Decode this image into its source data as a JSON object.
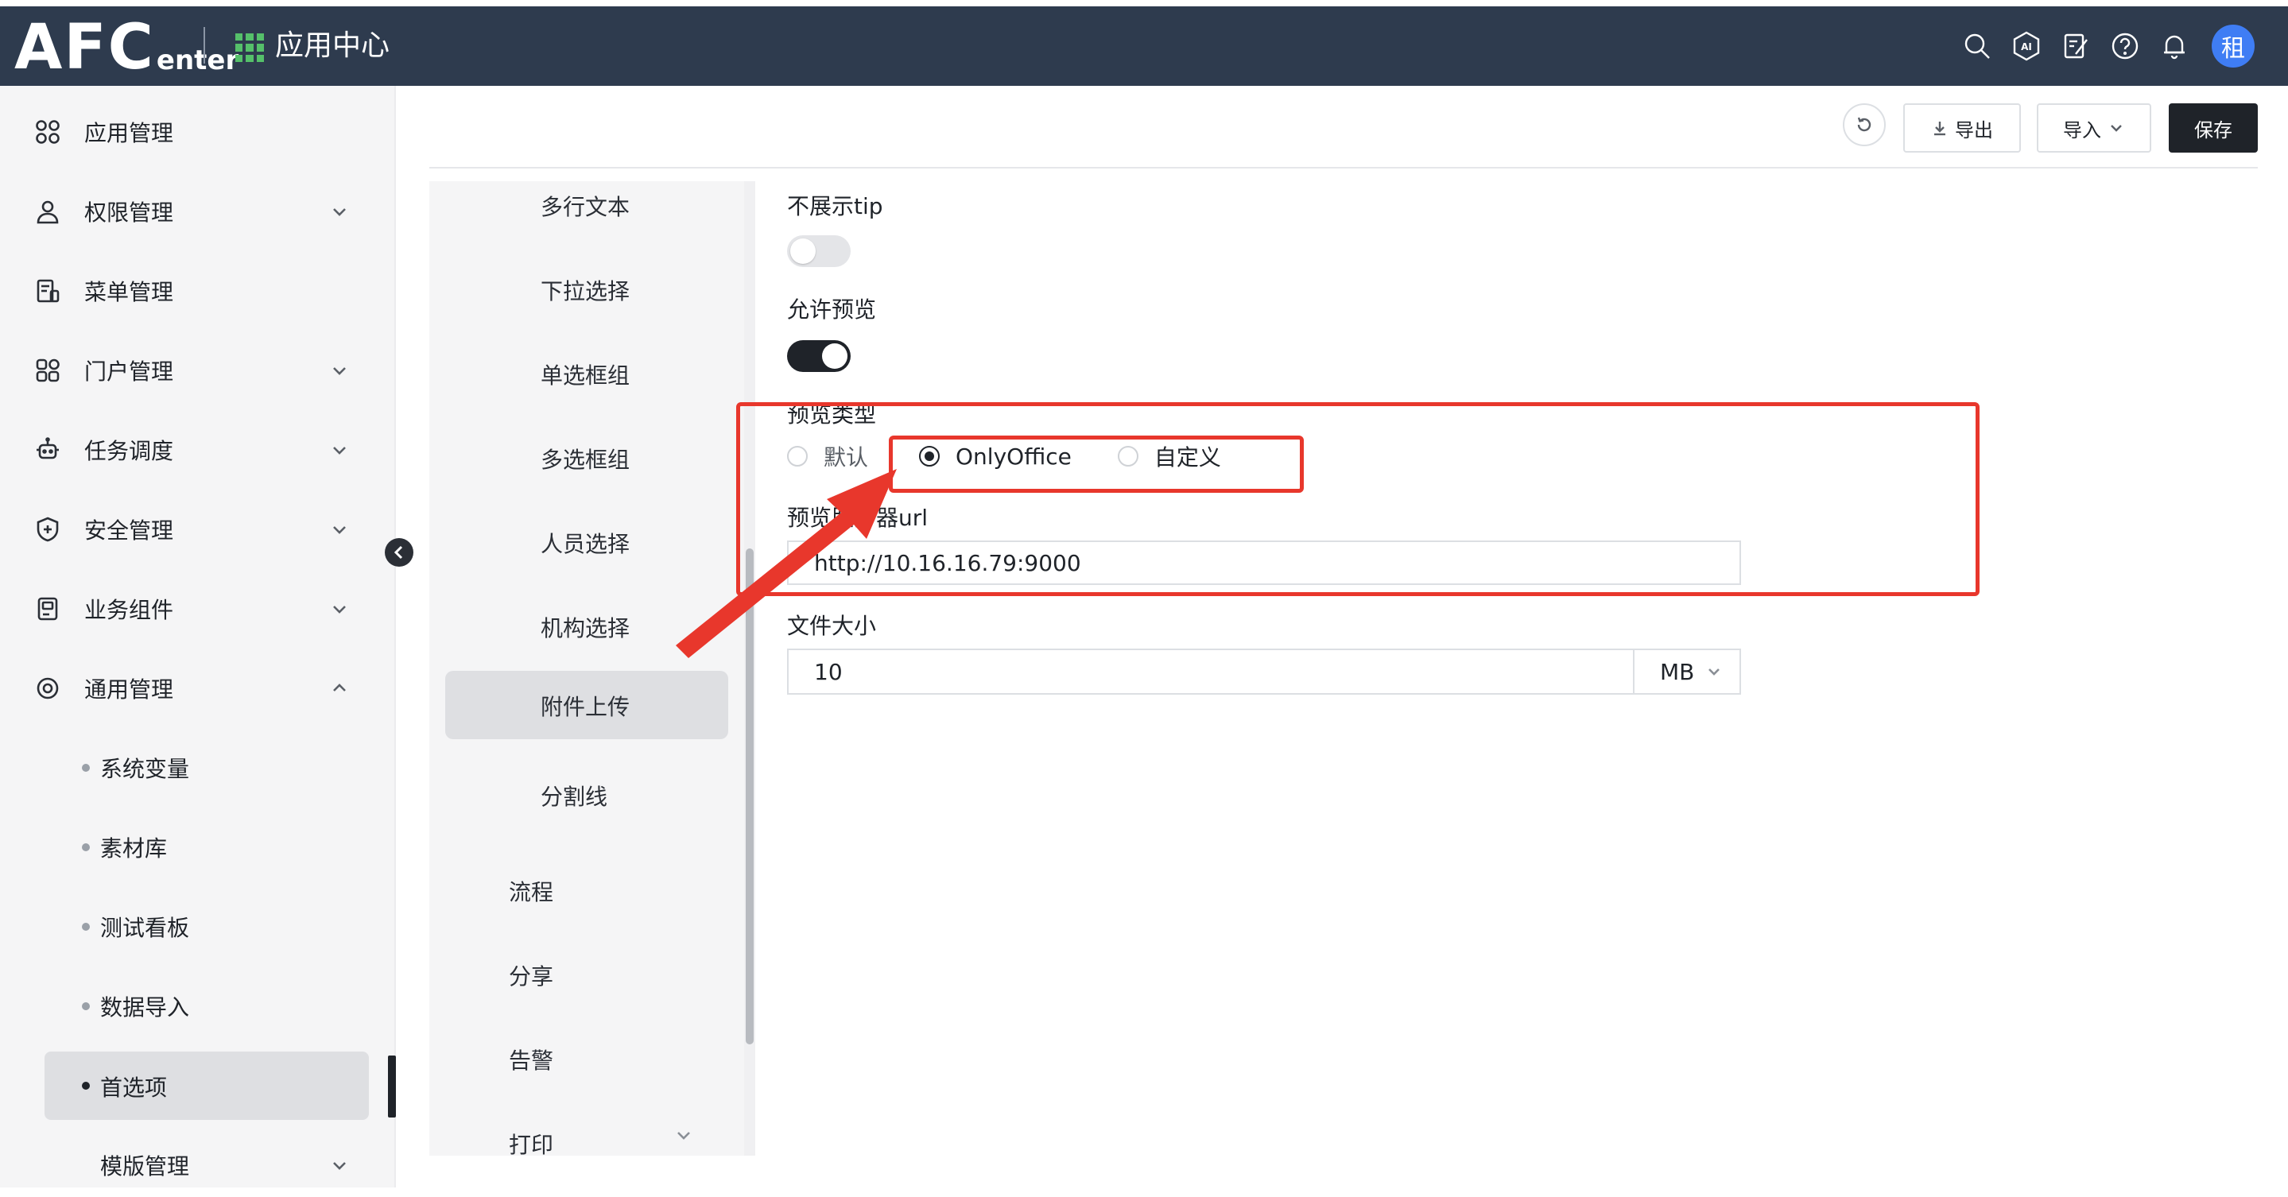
{
  "header": {
    "logo_main": "AFC",
    "logo_sub": "enter",
    "app_center": "应用中心",
    "avatar_text": "租",
    "icons": [
      "search-icon",
      "ai-icon",
      "edit-note-icon",
      "help-icon",
      "bell-icon"
    ]
  },
  "sidebar": {
    "items": [
      {
        "label": "应用管理",
        "icon": "grid-apps-icon",
        "expandable": false
      },
      {
        "label": "权限管理",
        "icon": "user-icon",
        "expandable": true
      },
      {
        "label": "菜单管理",
        "icon": "menu-doc-icon",
        "expandable": false
      },
      {
        "label": "门户管理",
        "icon": "portal-icon",
        "expandable": true
      },
      {
        "label": "任务调度",
        "icon": "robot-icon",
        "expandable": true
      },
      {
        "label": "安全管理",
        "icon": "shield-icon",
        "expandable": true
      },
      {
        "label": "业务组件",
        "icon": "component-icon",
        "expandable": true
      },
      {
        "label": "通用管理",
        "icon": "target-icon",
        "expandable": true,
        "expanded": true
      }
    ],
    "sub_items": [
      {
        "label": "系统变量"
      },
      {
        "label": "素材库"
      },
      {
        "label": "测试看板"
      },
      {
        "label": "数据导入"
      },
      {
        "label": "首选项",
        "active": true
      },
      {
        "label": "模版管理"
      }
    ]
  },
  "toolbar": {
    "export_label": "导出",
    "import_label": "导入",
    "save_label": "保存"
  },
  "middle_list": {
    "items": [
      {
        "label": "多行文本"
      },
      {
        "label": "下拉选择"
      },
      {
        "label": "单选框组"
      },
      {
        "label": "多选框组"
      },
      {
        "label": "人员选择"
      },
      {
        "label": "机构选择"
      },
      {
        "label": "附件上传",
        "active": true
      },
      {
        "label": "分割线"
      },
      {
        "label": "流程"
      },
      {
        "label": "分享"
      },
      {
        "label": "告警"
      },
      {
        "label": "打印"
      }
    ]
  },
  "form": {
    "hide_tip_label": "不展示tip",
    "hide_tip_on": false,
    "allow_preview_label": "允许预览",
    "allow_preview_on": true,
    "preview_type_label": "预览类型",
    "preview_type_options": [
      "默认",
      "OnlyOffice",
      "自定义"
    ],
    "preview_type_selected": "OnlyOffice",
    "preview_server_label": "预览服务器url",
    "preview_server_value": "http://10.16.16.79:9000",
    "file_size_label": "文件大小",
    "file_size_value": "10",
    "file_size_unit": "MB"
  },
  "colors": {
    "header_bg": "#2e3b4e",
    "accent_dark": "#1f2329",
    "annotation_red": "#e8372c",
    "app_grid_green": "#55c06a",
    "avatar_blue": "#3f7df4"
  }
}
